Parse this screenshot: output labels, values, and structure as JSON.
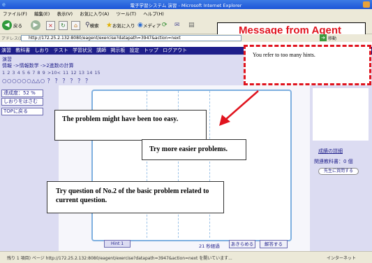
{
  "window": {
    "title": "電子学習システム 演習 - Microsoft Internet Explorer"
  },
  "menu": [
    "ファイル(F)",
    "編集(E)",
    "表示(V)",
    "お気に入り(A)",
    "ツール(T)",
    "ヘルプ(H)"
  ],
  "toolbar": {
    "back": "戻る",
    "search": "検索",
    "favorites": "お気に入り",
    "media": "メディア"
  },
  "address": {
    "label": "アドレス(D)",
    "url": "http://172.25.2.132:8080/eagent/exercise?datapath=3947&action=next",
    "go": "移動"
  },
  "agent_banner": "Message from Agent",
  "nav": [
    "演習",
    "教科書",
    "しおり",
    "テスト",
    "学習状況",
    "講師",
    "掲示板",
    "設定",
    "トップ",
    "ログアウト"
  ],
  "header": {
    "section": "演習",
    "breadcrumb": "情報 ->情報数学 ->2進数の計算",
    "question_numbers": "1 2 3 4 5 6 7 8 9 >10< 11 12 13 14 15",
    "result_marks": "○○○○○○△△○ ？ ？ ？ ？ ？ ？"
  },
  "left": {
    "progress": "達成度：52 %",
    "bookmark": "しおりをはさむ",
    "back_top": "TOPに戻る"
  },
  "right": {
    "grade_detail": "成績の詳細",
    "related_texts": "関連教科書：0 個",
    "ask_teacher": "先生に質問する"
  },
  "bottom": {
    "hint_button": "Hint 1",
    "timer": "21 秒経過",
    "give_up": "あきらめる",
    "answer": "解答する"
  },
  "agent_hint": "You refer to too many hints.",
  "notes": {
    "n1": "The problem might have been too easy.",
    "n2": "Try more easier problems.",
    "n3": "Try question of No.2  of the basic problem related to current question."
  },
  "status": {
    "text": "残り 1 項目) ページ http://172.25.2.132:8080/eagent/exercise?datapath=3947&action=next を開いています...",
    "zone": "インターネット"
  },
  "colors": {
    "nav_bg": "#1f1f8a",
    "panel_bg": "#dcdcf2",
    "accent_red": "#e0141e",
    "panel_border": "#7fb0e0"
  }
}
